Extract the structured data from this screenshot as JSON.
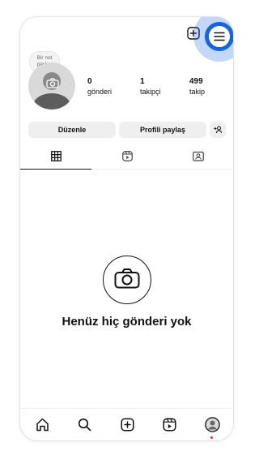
{
  "header": {
    "add_icon": "plus-square-icon",
    "menu_icon": "hamburger-menu-icon"
  },
  "note": {
    "text": "Bir not paylaş"
  },
  "profile": {
    "avatar_icon": "camera-icon",
    "stats": [
      {
        "value": "0",
        "label": "gönderi"
      },
      {
        "value": "1",
        "label": "takipçi"
      },
      {
        "value": "499",
        "label": "takip"
      }
    ]
  },
  "actions": {
    "edit_label": "Düzenle",
    "share_label": "Profili paylaş",
    "add_person_icon": "add-person-icon"
  },
  "tabs": [
    {
      "icon": "grid-icon",
      "active": true
    },
    {
      "icon": "reels-icon",
      "active": false
    },
    {
      "icon": "tagged-icon",
      "active": false
    }
  ],
  "empty_state": {
    "icon": "camera-icon",
    "text": "Henüz hiç gönderi yok"
  },
  "bottom_nav": [
    "home-icon",
    "search-icon",
    "create-icon",
    "reels-icon",
    "profile-icon"
  ],
  "colors": {
    "highlight": "#1565e0",
    "notification_dot": "#e0245e"
  }
}
